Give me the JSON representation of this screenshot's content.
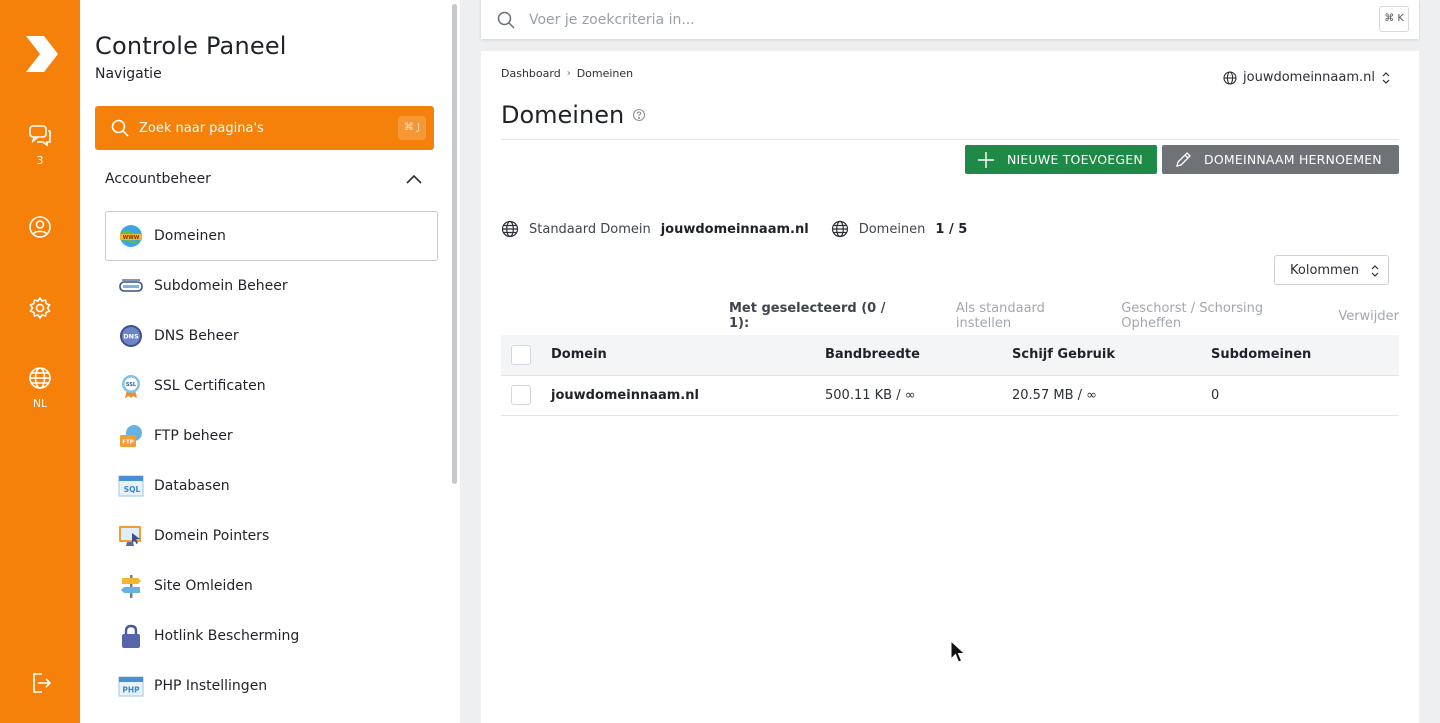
{
  "rail": {
    "items": [
      {
        "icon": "chat-icon",
        "label": "3"
      },
      {
        "icon": "user-icon",
        "label": ""
      },
      {
        "icon": "gear-icon",
        "label": ""
      },
      {
        "icon": "globe-icon",
        "label": "NL"
      },
      {
        "icon": "logout-icon",
        "label": ""
      }
    ],
    "accent": "#f5800a"
  },
  "nav": {
    "title": "Controle Paneel",
    "subtitle": "Navigatie",
    "search_placeholder": "Zoek naar pagina's",
    "search_shortcut": "⌘ J",
    "section": "Accountbeheer",
    "items": [
      {
        "label": "Domeinen",
        "icon": "www-globe-icon",
        "active": true
      },
      {
        "label": "Subdomein Beheer",
        "icon": "subdomain-icon"
      },
      {
        "label": "DNS Beheer",
        "icon": "dns-icon"
      },
      {
        "label": "SSL Certificaten",
        "icon": "ssl-badge-icon"
      },
      {
        "label": "FTP beheer",
        "icon": "ftp-folder-icon"
      },
      {
        "label": "Databasen",
        "icon": "sql-icon"
      },
      {
        "label": "Domein Pointers",
        "icon": "monitor-pointer-icon"
      },
      {
        "label": "Site Omleiden",
        "icon": "signpost-icon"
      },
      {
        "label": "Hotlink Bescherming",
        "icon": "padlock-icon"
      },
      {
        "label": "PHP Instellingen",
        "icon": "php-icon"
      }
    ]
  },
  "topsearch": {
    "placeholder": "Voer je zoekcriteria in...",
    "shortcut": "⌘ K"
  },
  "main": {
    "breadcrumb": [
      "Dashboard",
      "Domeinen"
    ],
    "domain_selector": "jouwdomeinnaam.nl",
    "title": "Domeinen",
    "buttons": {
      "add": "NIEUWE TOEVOEGEN",
      "rename": "DOMEINNAAM HERNOEMEN"
    },
    "stats": {
      "default_label": "Standaard Domein",
      "default_value": "jouwdomeinnaam.nl",
      "domains_label": "Domeinen",
      "domains_value": "1 / 5"
    },
    "columns_button": "Kolommen",
    "bulk": {
      "label": "Met geselecteerd (0 / 1):",
      "actions": [
        "Als standaard instellen",
        "Geschorst / Schorsing Opheffen",
        "Verwijder"
      ]
    },
    "table": {
      "headers": [
        "Domein",
        "Bandbreedte",
        "Schijf Gebruik",
        "Subdomeinen"
      ],
      "rows": [
        [
          "jouwdomeinnaam.nl",
          "500.11 KB / ∞",
          "20.57 MB / ∞",
          "0"
        ]
      ]
    }
  },
  "colors": {
    "orange": "#f5800a",
    "green": "#1f8a47",
    "grey_button": "#6f7378"
  }
}
